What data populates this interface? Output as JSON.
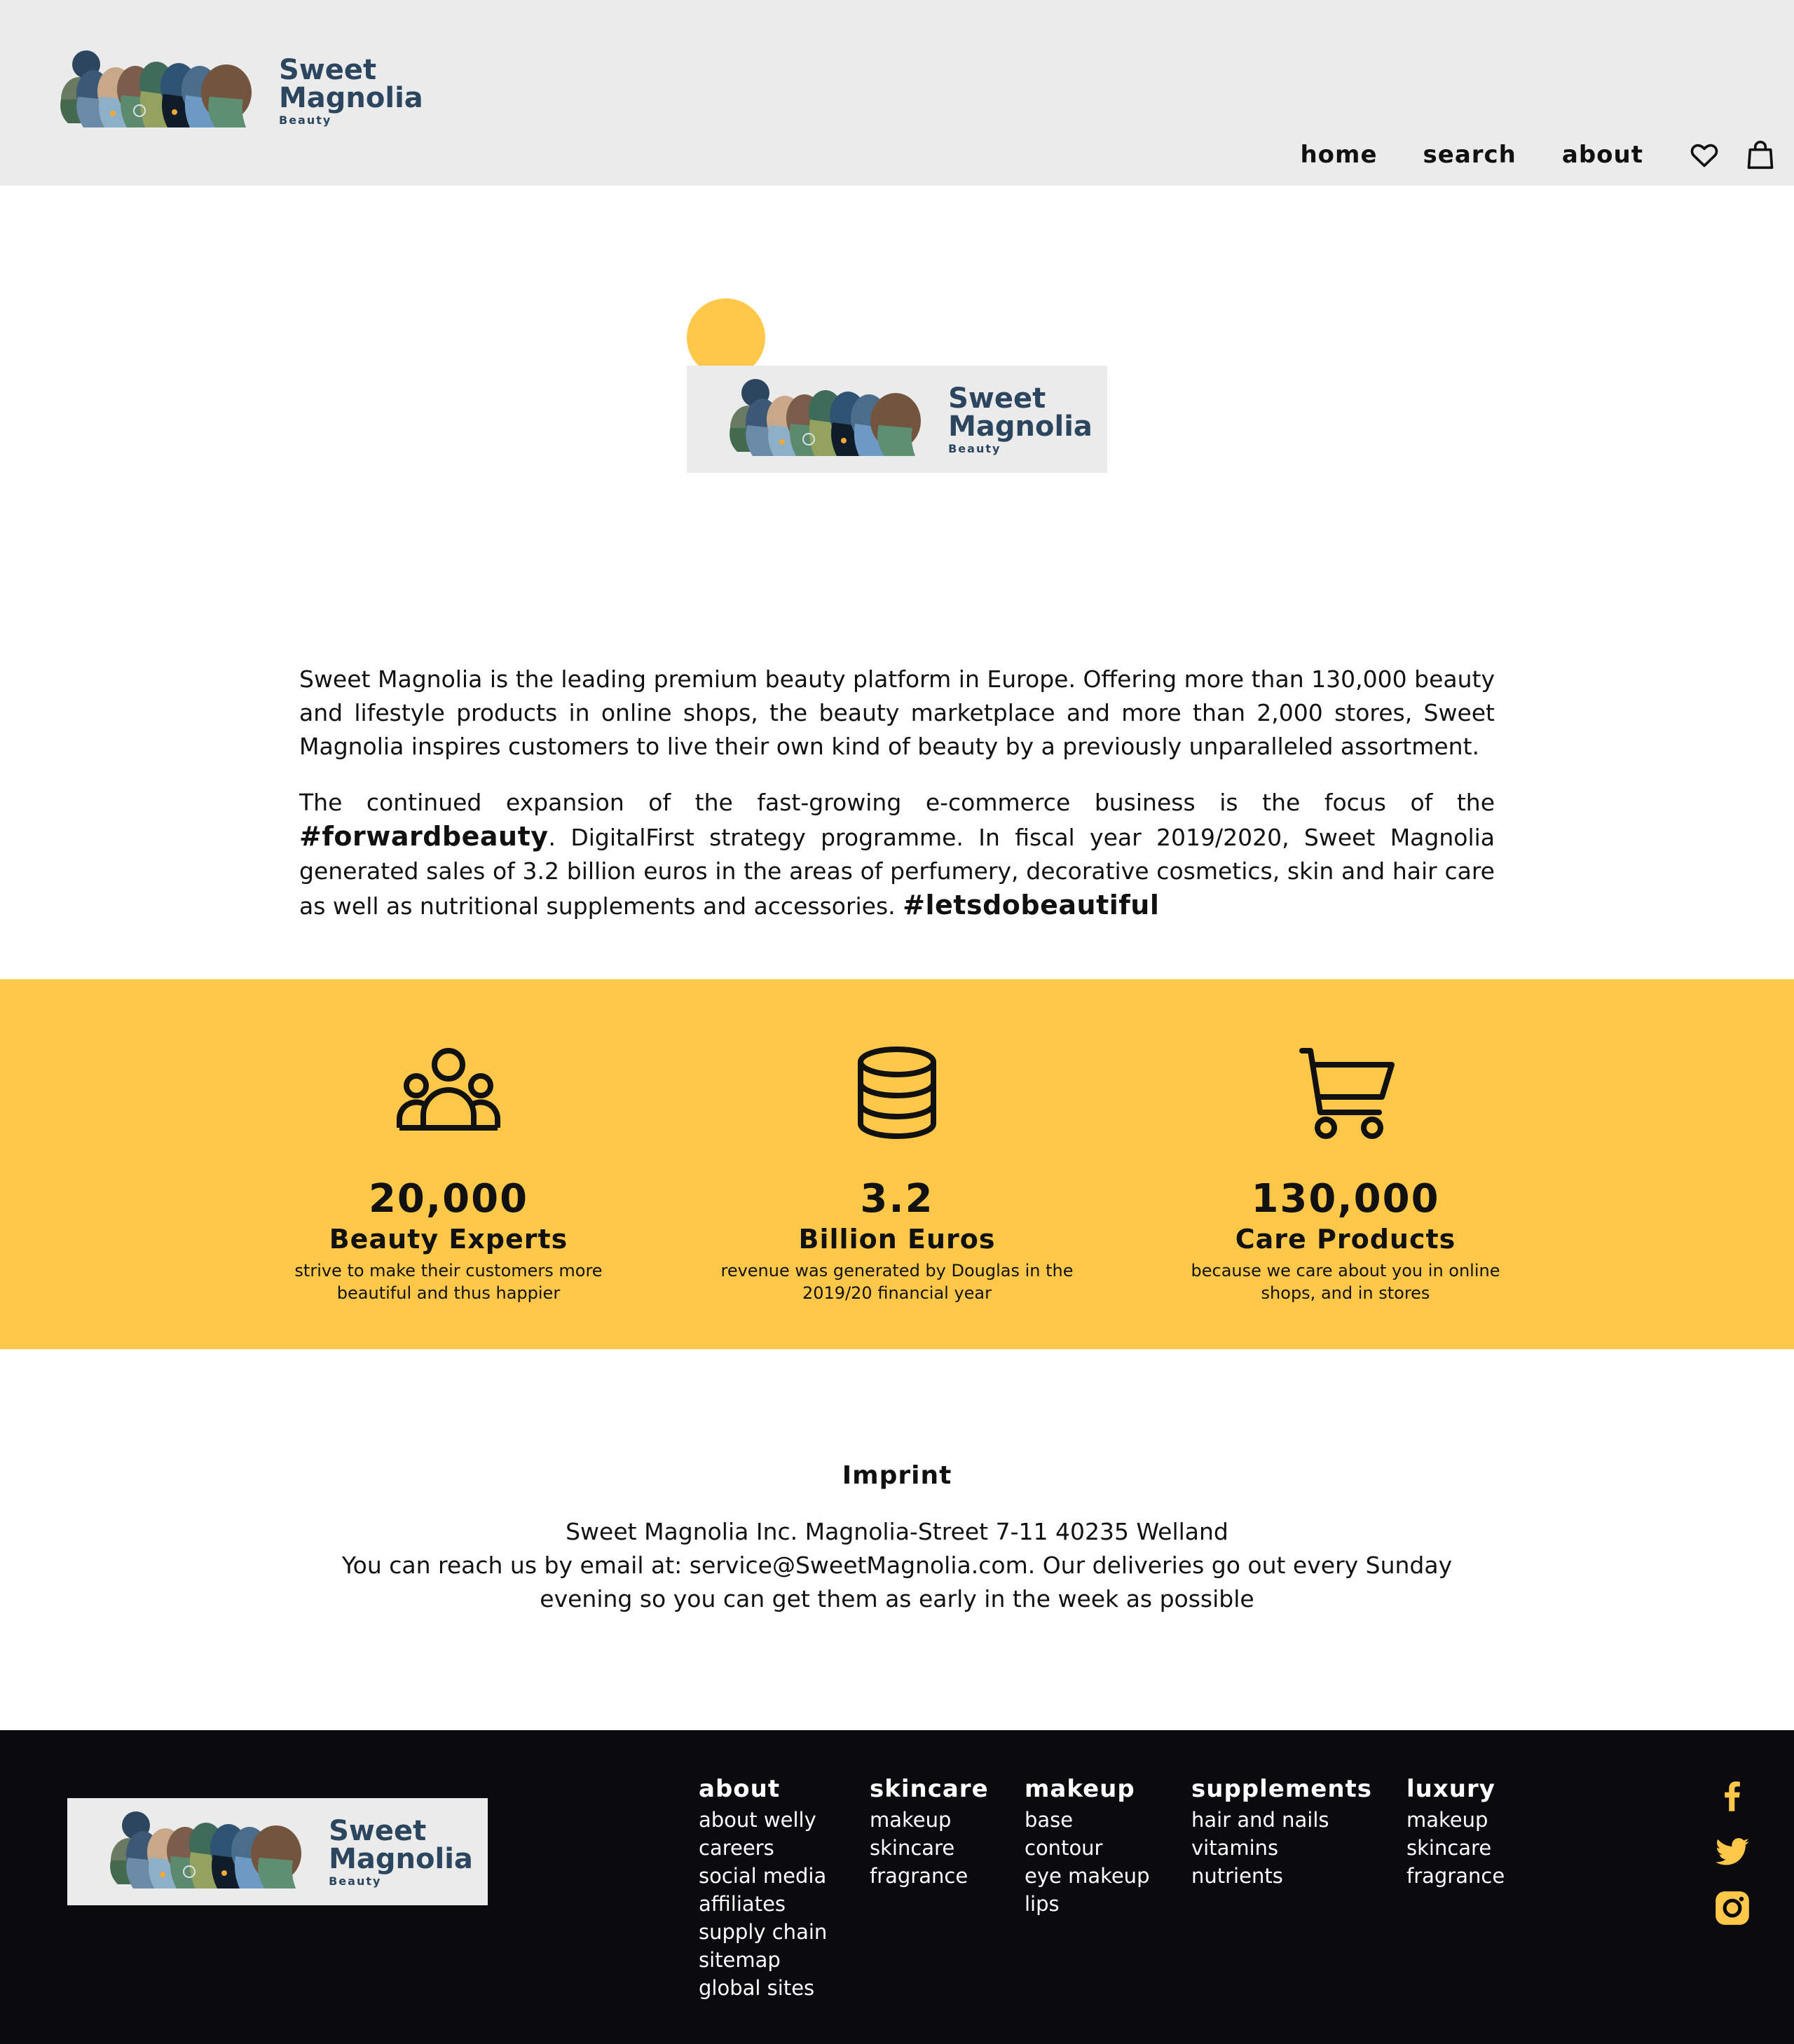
{
  "brand": {
    "name_line1": "Sweet",
    "name_line2": "Magnolia",
    "tagline": "Beauty"
  },
  "header": {
    "nav": [
      "home",
      "search",
      "about"
    ],
    "icons": [
      "heart-icon",
      "shopping-bag-icon"
    ]
  },
  "intro": {
    "paragraph1": "Sweet Magnolia is the leading premium beauty platform in Europe. Offering more than 130,000 beauty and lifestyle products in online shops, the beauty marketplace and more than 2,000 stores, Sweet Magnolia inspires customers to live their own kind of beauty by a previously unparalleled assortment.",
    "paragraph2_before": "The continued expansion of the fast-growing e-commerce business is the focus of the ",
    "hashtag1": "#forwardbeauty",
    "paragraph2_after": ". DigitalFirst strategy programme. In fiscal year 2019/2020, Sweet Magnolia generated sales of 3.2 billion euros in the areas of perfumery, decorative cosmetics, skin and hair care as well as nutritional supplements and accessories. ",
    "hashtag2": "#letsdobeautiful"
  },
  "stats": [
    {
      "icon": "people-group-icon",
      "number": "20,000",
      "label": "Beauty Experts",
      "desc": "strive to make their customers more beautiful and thus happier"
    },
    {
      "icon": "coin-stack-icon",
      "number": "3.2",
      "label": "Billion Euros",
      "desc": "revenue was generated by Douglas in the 2019/20 financial year"
    },
    {
      "icon": "shopping-cart-icon",
      "number": "130,000",
      "label": "Care Products",
      "desc": "because we care about you in online shops, and in stores"
    }
  ],
  "imprint": {
    "title": "Imprint",
    "line1": "Sweet Magnolia Inc. Magnolia-Street 7-11 40235 Welland",
    "line2": "You can reach us by email at: service@SweetMagnolia.com. Our deliveries go out every Sunday evening so you can get them as early in the week as possible"
  },
  "footer": {
    "columns": [
      {
        "heading": "about",
        "items": [
          "about welly",
          "careers",
          "social media",
          "affiliates",
          "supply chain",
          "sitemap",
          "global sites"
        ]
      },
      {
        "heading": "skincare",
        "items": [
          "makeup",
          "skincare",
          "fragrance"
        ]
      },
      {
        "heading": "makeup",
        "items": [
          "base",
          "contour",
          "eye makeup",
          "lips"
        ]
      },
      {
        "heading": "supplements",
        "items": [
          "hair and nails",
          "vitamins",
          "nutrients"
        ]
      },
      {
        "heading": "luxury",
        "items": [
          "makeup",
          "skincare",
          "fragrance"
        ]
      }
    ],
    "social": [
      "facebook-icon",
      "twitter-icon",
      "instagram-icon"
    ]
  },
  "colors": {
    "accent": "#fdc74a",
    "header_bg": "#ebebeb",
    "footer_bg": "#0b0a0e",
    "logo_text": "#2c4660"
  }
}
